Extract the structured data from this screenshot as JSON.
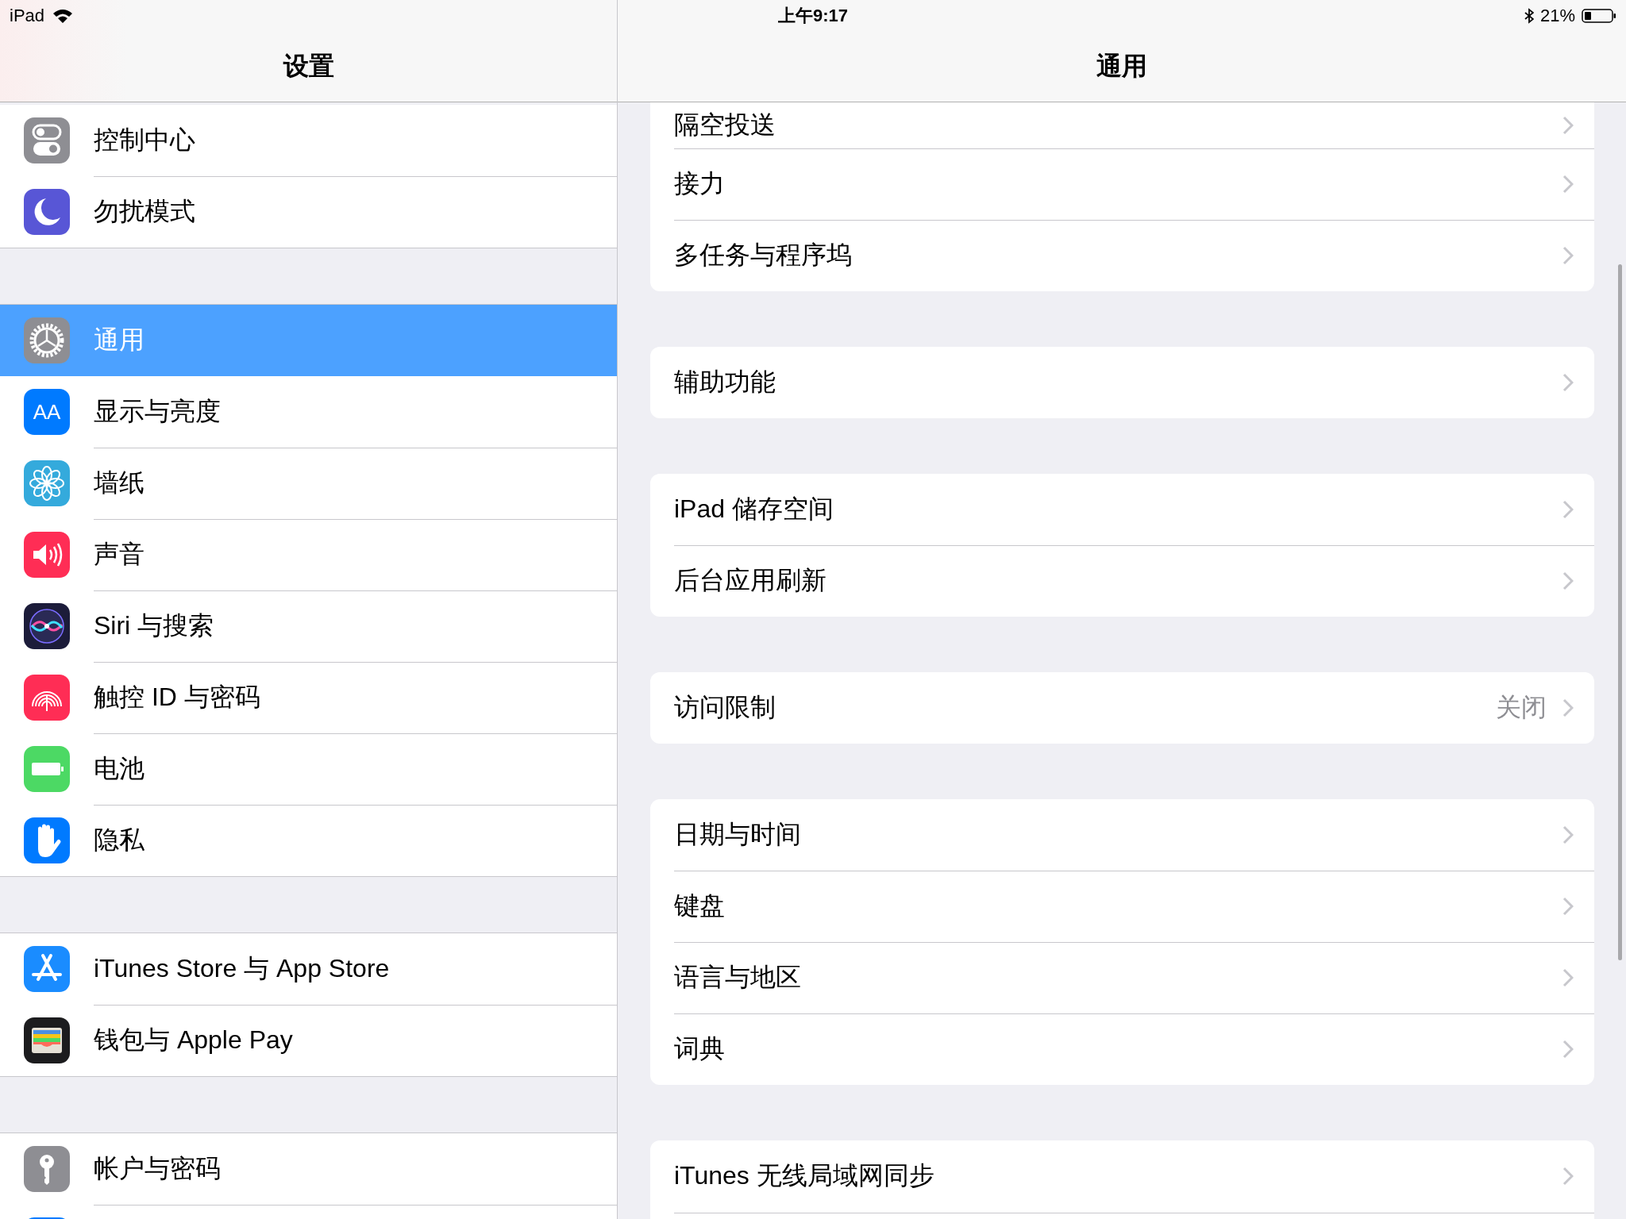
{
  "status_bar": {
    "carrier": "iPad",
    "time": "上午9:17",
    "battery": "21%"
  },
  "sidebar": {
    "title": "设置",
    "groups": [
      [
        {
          "label": "控制中心",
          "kind": "toggles",
          "selected": false
        },
        {
          "label": "勿扰模式",
          "kind": "moon",
          "selected": false
        }
      ],
      [
        {
          "label": "通用",
          "kind": "gear",
          "selected": true
        },
        {
          "label": "显示与亮度",
          "kind": "letters",
          "glyph": "AA",
          "selected": false
        },
        {
          "label": "墙纸",
          "kind": "flower",
          "selected": false
        },
        {
          "label": "声音",
          "kind": "speaker",
          "selected": false
        },
        {
          "label": "Siri 与搜索",
          "kind": "siri",
          "selected": false
        },
        {
          "label": "触控 ID 与密码",
          "kind": "fingerprint",
          "selected": false
        },
        {
          "label": "电池",
          "kind": "battery",
          "selected": false
        },
        {
          "label": "隐私",
          "kind": "hand",
          "selected": false
        }
      ],
      [
        {
          "label": "iTunes Store 与 App Store",
          "kind": "appstore",
          "selected": false
        },
        {
          "label": "钱包与 Apple Pay",
          "kind": "wallet",
          "selected": false
        }
      ],
      [
        {
          "label": "帐户与密码",
          "kind": "key",
          "selected": false
        },
        {
          "kind": "blank",
          "selected": false
        }
      ]
    ]
  },
  "detail": {
    "title": "通用",
    "groups": [
      [
        {
          "label": "隔空投送"
        },
        {
          "label": "接力"
        },
        {
          "label": "多任务与程序坞"
        }
      ],
      [
        {
          "label": "辅助功能"
        }
      ],
      [
        {
          "label": "iPad 储存空间"
        },
        {
          "label": "后台应用刷新"
        }
      ],
      [
        {
          "label": "访问限制",
          "value": "关闭"
        }
      ],
      [
        {
          "label": "日期与时间"
        },
        {
          "label": "键盘"
        },
        {
          "label": "语言与地区"
        },
        {
          "label": "词典"
        }
      ],
      [
        {
          "label": "iTunes 无线局域网同步"
        }
      ]
    ]
  }
}
